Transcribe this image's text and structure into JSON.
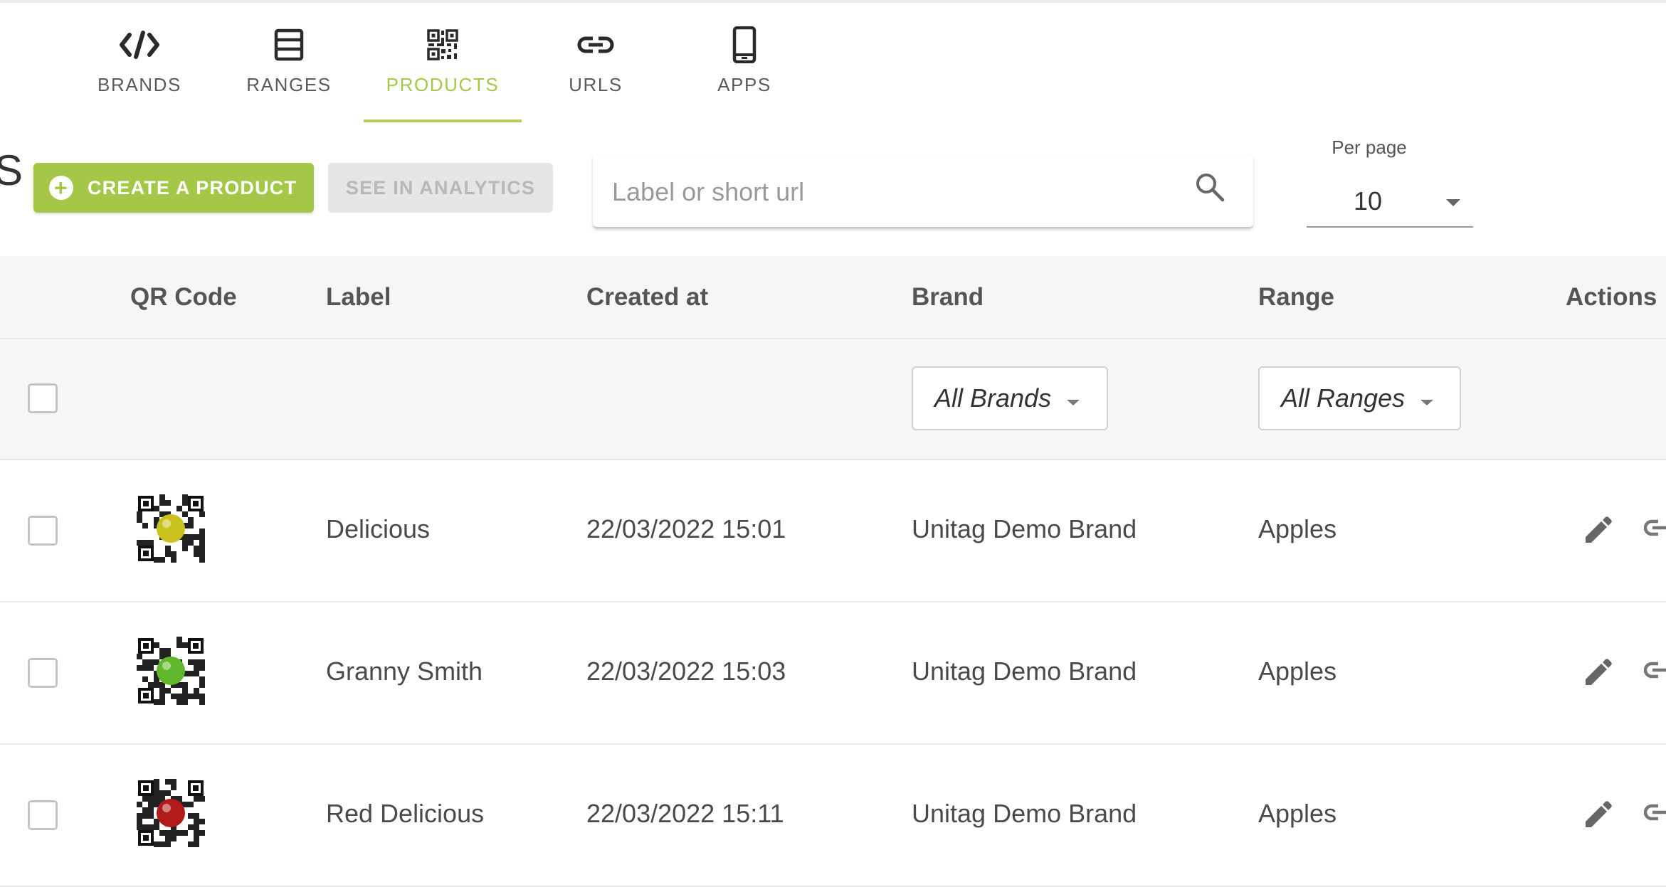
{
  "tabs": [
    {
      "label": "BRANDS",
      "icon": "code-icon",
      "active": false
    },
    {
      "label": "RANGES",
      "icon": "list-icon",
      "active": false
    },
    {
      "label": "PRODUCTS",
      "icon": "qr-code-icon",
      "active": true
    },
    {
      "label": "URLS",
      "icon": "link-icon",
      "active": false
    },
    {
      "label": "APPS",
      "icon": "phone-icon",
      "active": false
    }
  ],
  "page_title_fragment": "S",
  "toolbar": {
    "create_label": "CREATE A PRODUCT",
    "analytics_label": "SEE IN ANALYTICS",
    "search_placeholder": "Label or short url",
    "search_value": "",
    "per_page_label": "Per page",
    "per_page_value": "10"
  },
  "table": {
    "headers": [
      "QR Code",
      "Label",
      "Created at",
      "Brand",
      "Range",
      "Actions"
    ],
    "filters": {
      "brand": "All Brands",
      "range": "All Ranges"
    },
    "rows": [
      {
        "label": "Delicious",
        "created_at": "22/03/2022 15:01",
        "brand": "Unitag Demo Brand",
        "range": "Apples",
        "qr_color": "#c9c21f"
      },
      {
        "label": "Granny Smith",
        "created_at": "22/03/2022 15:03",
        "brand": "Unitag Demo Brand",
        "range": "Apples",
        "qr_color": "#5fb82a"
      },
      {
        "label": "Red Delicious",
        "created_at": "22/03/2022 15:11",
        "brand": "Unitag Demo Brand",
        "range": "Apples",
        "qr_color": "#b01a1a"
      }
    ]
  },
  "colors": {
    "accent": "#a5c748",
    "header_bg": "#f4f6f8",
    "disabled_bg": "#e6e6e6"
  }
}
